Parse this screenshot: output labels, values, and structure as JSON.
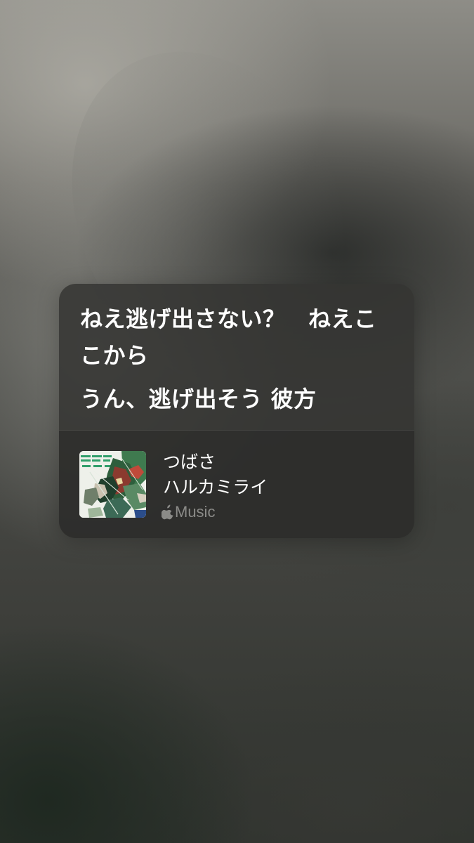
{
  "lyrics": {
    "line1": "ねえ逃げ出さない？　ねえここから",
    "line2": "うん、逃げ出そう 彼方"
  },
  "track": {
    "title": "つばさ",
    "artist": "ハルカミライ",
    "service": "Music",
    "service_icon": "apple-icon",
    "artwork": "album-artwork"
  }
}
